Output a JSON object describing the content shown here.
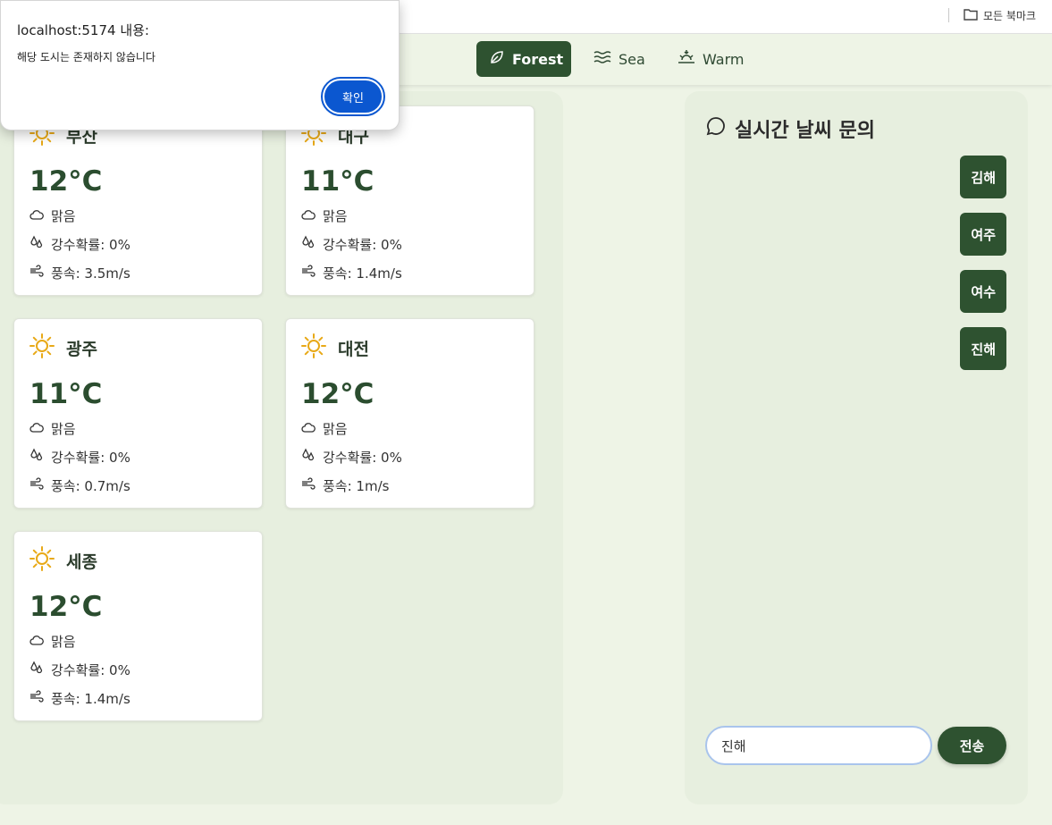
{
  "browser": {
    "bookmarks_label": "모든 북마크"
  },
  "themes": [
    {
      "label": "Forest",
      "active": true
    },
    {
      "label": "Sea",
      "active": false
    },
    {
      "label": "Warm",
      "active": false
    }
  ],
  "weather_cards": [
    {
      "city": "부산",
      "temp": "12°C",
      "condition": "맑음",
      "precip": "강수확률: 0%",
      "wind": "풍속: 3.5m/s"
    },
    {
      "city": "대구",
      "temp": "11°C",
      "condition": "맑음",
      "precip": "강수확률: 0%",
      "wind": "풍속: 1.4m/s"
    },
    {
      "city": "광주",
      "temp": "11°C",
      "condition": "맑음",
      "precip": "강수확률: 0%",
      "wind": "풍속: 0.7m/s"
    },
    {
      "city": "대전",
      "temp": "12°C",
      "condition": "맑음",
      "precip": "강수확률: 0%",
      "wind": "풍속: 1m/s"
    },
    {
      "city": "세종",
      "temp": "12°C",
      "condition": "맑음",
      "precip": "강수확률: 0%",
      "wind": "풍속: 1.4m/s"
    }
  ],
  "chat": {
    "title": "실시간 날씨 문의",
    "messages": [
      "김해",
      "여주",
      "여수",
      "진해"
    ],
    "input_value": "진해",
    "send_label": "전송"
  },
  "dialog": {
    "title": "localhost:5174 내용:",
    "message": "해당 도시는 존재하지 않습니다",
    "ok_label": "확인"
  },
  "colors": {
    "brand_green": "#2e5230",
    "background": "#eef4e6",
    "sun": "#e8a917",
    "dialog_button": "#0b57d0"
  }
}
